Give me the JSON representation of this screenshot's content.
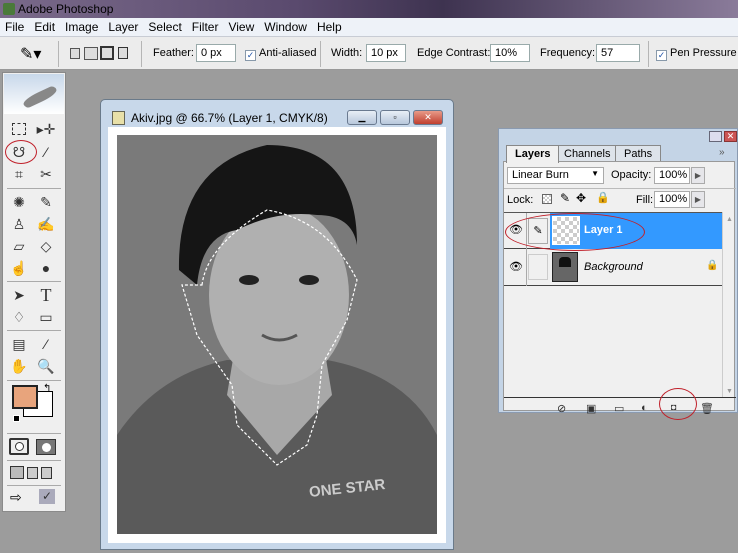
{
  "app": {
    "title": "Adobe Photoshop"
  },
  "menu": [
    "File",
    "Edit",
    "Image",
    "Layer",
    "Select",
    "Filter",
    "View",
    "Window",
    "Help"
  ],
  "options": {
    "feather_label": "Feather:",
    "feather_value": "0 px",
    "antialiased_label": "Anti-aliased",
    "antialiased_checked": true,
    "width_label": "Width:",
    "width_value": "10 px",
    "edge_contrast_label": "Edge Contrast:",
    "edge_contrast_value": "10%",
    "frequency_label": "Frequency:",
    "frequency_value": "57",
    "pen_pressure_label": "Pen Pressure",
    "pen_pressure_checked": true
  },
  "toolbox": {
    "foreground_color": "#e8a47c",
    "background_color": "#ffffff",
    "type_tool_glyph": "T"
  },
  "document": {
    "title": "Akiv.jpg @ 66.7% (Layer 1, CMYK/8)",
    "shirt_text": "ONE STAR"
  },
  "layers_panel": {
    "tabs": [
      "Layers",
      "Channels",
      "Paths"
    ],
    "blend_mode": "Linear Burn",
    "opacity_label": "Opacity:",
    "opacity_value": "100%",
    "lock_label": "Lock:",
    "fill_label": "Fill:",
    "fill_value": "100%",
    "layers": [
      {
        "name": "Layer 1",
        "selected": true,
        "visible": true
      },
      {
        "name": "Background",
        "selected": false,
        "visible": true,
        "locked": true
      }
    ]
  },
  "colors": {
    "selection": "#3399ff",
    "annotation": "#c0202a"
  }
}
